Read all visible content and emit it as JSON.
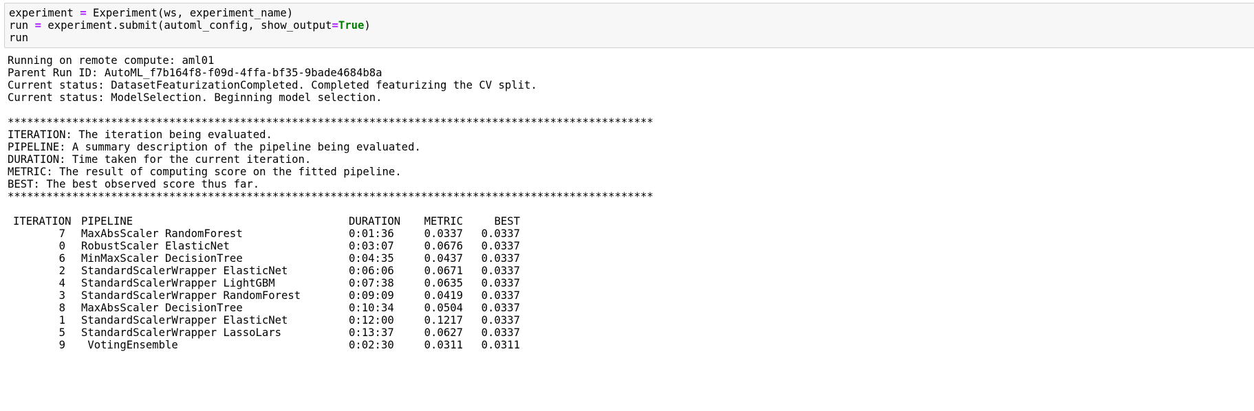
{
  "code_cell": {
    "line1": {
      "pre": "experiment ",
      "op": "=",
      "post": " Experiment(ws, experiment_name)"
    },
    "line2": {
      "pre": "run ",
      "op": "=",
      "mid": " experiment.submit(automl_config, show_output",
      "op2": "=",
      "kw": "True",
      "post": ")"
    },
    "line3": "run"
  },
  "output": {
    "header_lines": [
      "Running on remote compute: aml01",
      "Parent Run ID: AutoML_f7b164f8-f09d-4ffa-bf35-9bade4684b8a",
      "Current status: DatasetFeaturizationCompleted. Completed featurizing the CV split.",
      "Current status: ModelSelection. Beginning model selection."
    ],
    "separator": "****************************************************************************************************",
    "legend_lines": [
      "ITERATION: The iteration being evaluated.",
      "PIPELINE: A summary description of the pipeline being evaluated.",
      "DURATION: Time taken for the current iteration.",
      "METRIC: The result of computing score on the fitted pipeline.",
      "BEST: The best observed score thus far."
    ]
  },
  "table": {
    "columns": {
      "iteration": "ITERATION",
      "pipeline": "PIPELINE",
      "duration": "DURATION",
      "metric": "METRIC",
      "best": "BEST"
    },
    "rows": [
      {
        "iteration": "7",
        "pipeline": "MaxAbsScaler RandomForest",
        "duration": "0:01:36",
        "metric": "0.0337",
        "best": "0.0337"
      },
      {
        "iteration": "0",
        "pipeline": "RobustScaler ElasticNet",
        "duration": "0:03:07",
        "metric": "0.0676",
        "best": "0.0337"
      },
      {
        "iteration": "6",
        "pipeline": "MinMaxScaler DecisionTree",
        "duration": "0:04:35",
        "metric": "0.0437",
        "best": "0.0337"
      },
      {
        "iteration": "2",
        "pipeline": "StandardScalerWrapper ElasticNet",
        "duration": "0:06:06",
        "metric": "0.0671",
        "best": "0.0337"
      },
      {
        "iteration": "4",
        "pipeline": "StandardScalerWrapper LightGBM",
        "duration": "0:07:38",
        "metric": "0.0635",
        "best": "0.0337"
      },
      {
        "iteration": "3",
        "pipeline": "StandardScalerWrapper RandomForest",
        "duration": "0:09:09",
        "metric": "0.0419",
        "best": "0.0337"
      },
      {
        "iteration": "8",
        "pipeline": "MaxAbsScaler DecisionTree",
        "duration": "0:10:34",
        "metric": "0.0504",
        "best": "0.0337"
      },
      {
        "iteration": "1",
        "pipeline": "StandardScalerWrapper ElasticNet",
        "duration": "0:12:00",
        "metric": "0.1217",
        "best": "0.0337"
      },
      {
        "iteration": "5",
        "pipeline": "StandardScalerWrapper LassoLars",
        "duration": "0:13:37",
        "metric": "0.0627",
        "best": "0.0337"
      },
      {
        "iteration": "9",
        "pipeline": " VotingEnsemble",
        "duration": "0:02:30",
        "metric": "0.0311",
        "best": "0.0311"
      }
    ]
  },
  "colors": {
    "cell_background": "#f7f7f7",
    "cell_border": "#cfcfcf",
    "operator": "#aa22ff",
    "keyword": "#008000"
  }
}
